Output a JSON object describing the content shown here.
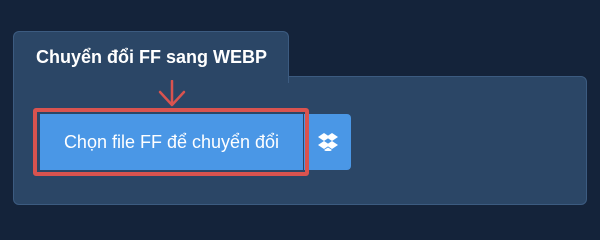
{
  "converter": {
    "tab_title": "Chuyển đổi FF sang WEBP",
    "choose_file_label": "Chọn file FF để chuyển đổi",
    "dropbox_icon": "dropbox-icon"
  },
  "colors": {
    "background": "#14233a",
    "panel": "#2b4666",
    "button": "#4a97e6",
    "highlight": "#d9534f"
  }
}
